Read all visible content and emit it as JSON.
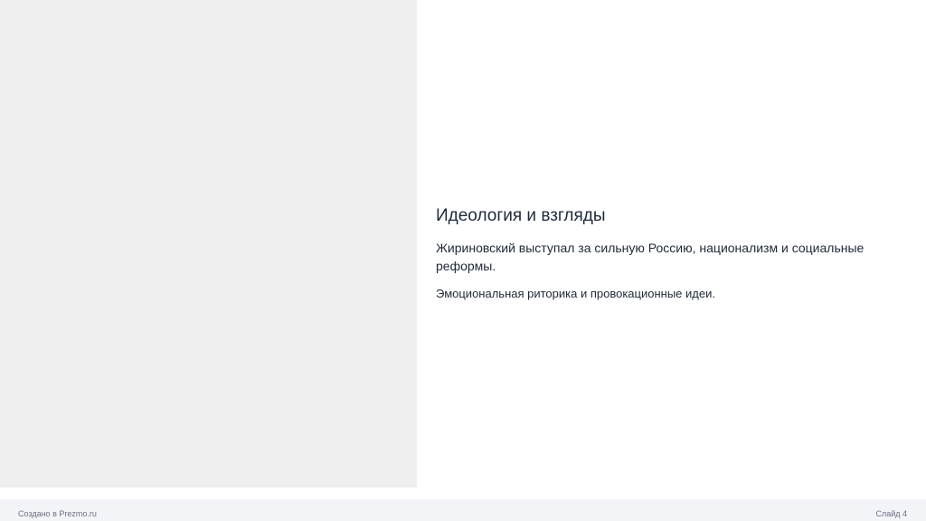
{
  "slide": {
    "title": "Идеология и взгляды",
    "paragraphs": [
      "Жириновский выступал за сильную Россию, национализм и социальные реформы.",
      "Эмоциональная риторика и провокационные идеи."
    ]
  },
  "footer": {
    "created_with": "Создано в Prezmo.ru",
    "slide_number": "Слайд 4"
  }
}
